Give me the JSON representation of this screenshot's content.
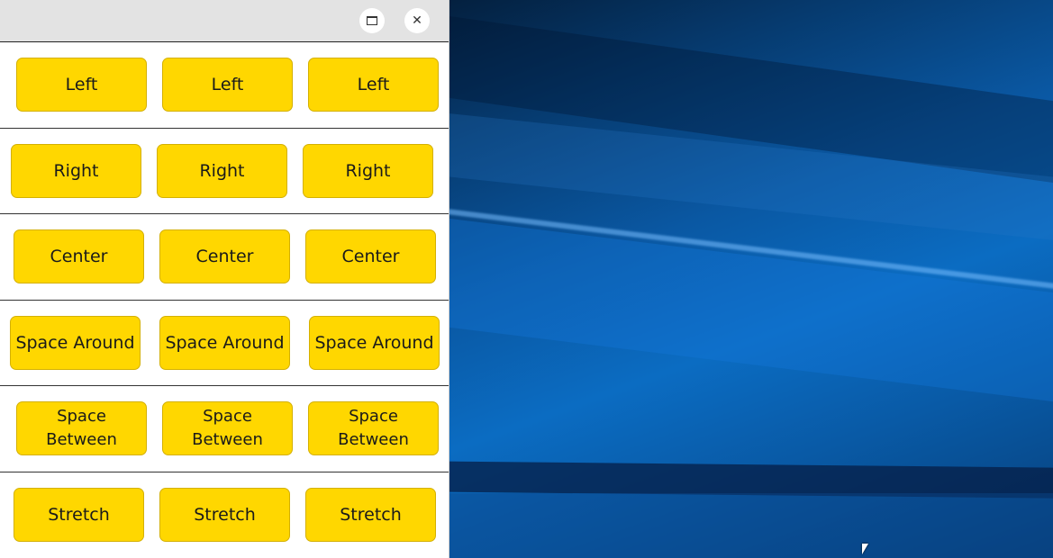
{
  "window": {
    "rows": [
      {
        "name": "left",
        "buttons": [
          "Left",
          "Left",
          "Left"
        ]
      },
      {
        "name": "right",
        "buttons": [
          "Right",
          "Right",
          "Right"
        ]
      },
      {
        "name": "center",
        "buttons": [
          "Center",
          "Center",
          "Center"
        ]
      },
      {
        "name": "space-around",
        "buttons": [
          "Space Around",
          "Space Around",
          "Space Around"
        ]
      },
      {
        "name": "space-between",
        "buttons": [
          "Space\nBetween",
          "Space\nBetween",
          "Space\nBetween"
        ]
      },
      {
        "name": "stretch",
        "buttons": [
          "Stretch",
          "Stretch",
          "Stretch"
        ]
      }
    ]
  },
  "icons": {
    "maximize": "maximize-icon",
    "close": "close-icon"
  },
  "colors": {
    "button_fill": "#ffd700",
    "button_border": "#d4b000",
    "titlebar": "#e3e3e3"
  }
}
